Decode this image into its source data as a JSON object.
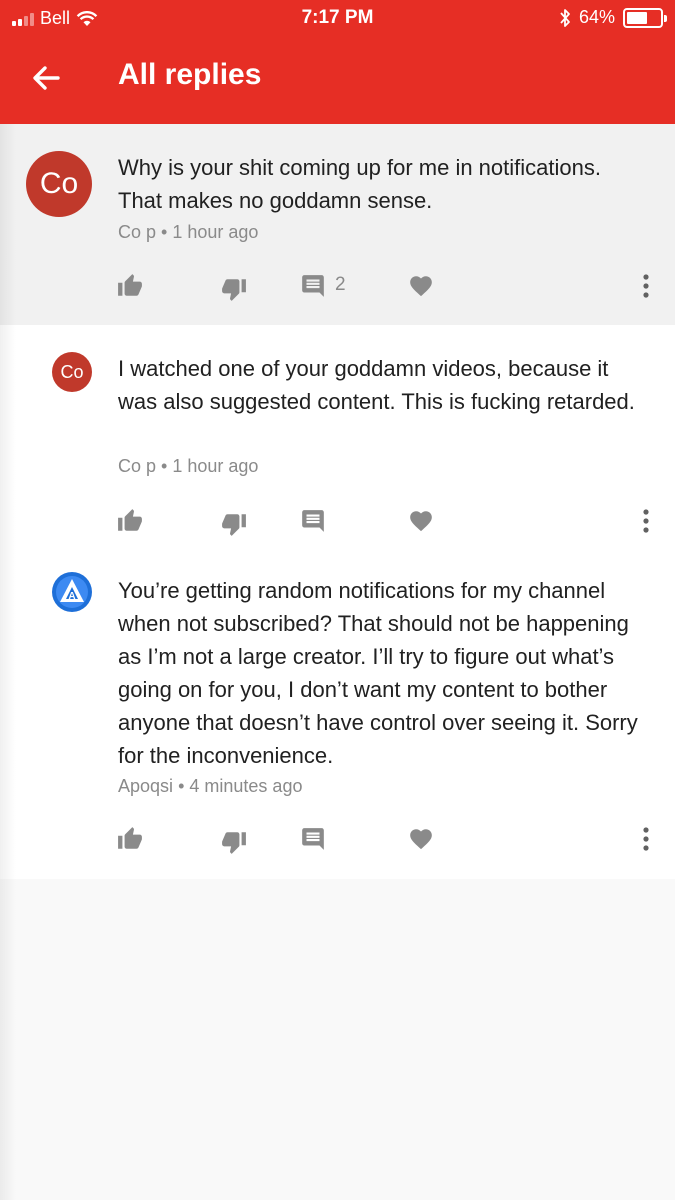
{
  "status_bar": {
    "carrier": "Bell",
    "time": "7:17 PM",
    "battery": "64%",
    "battery_level": 0.64
  },
  "header": {
    "title": "All replies",
    "accent_color": "#e62e25"
  },
  "comments": [
    {
      "avatar_text": "Co",
      "text": "Why is your shit coming up for me in notifications. That makes no goddamn sense.",
      "author": "Co p",
      "separator": "•",
      "time": "1 hour ago",
      "reply_count": "2"
    },
    {
      "avatar_text": "Co",
      "text": "I watched one of your goddamn videos, because it was also suggested content. This is fucking retarded.",
      "author": "Co p",
      "separator": "•",
      "time": "1 hour ago"
    },
    {
      "avatar_text": "A",
      "text": "You’re getting random notifications for my channel when not subscribed? That should not be happening as I’m not a large creator. I’ll try to figure out what’s going on for you, I don’t want my content to bother anyone that doesn’t have control over seeing it. Sorry for the inconvenience.",
      "author": "Apoqsi",
      "separator": "•",
      "time": "4 minutes ago"
    }
  ],
  "icons": [
    "back-arrow-icon",
    "thumbs-up-icon",
    "thumbs-down-icon",
    "reply-icon",
    "heart-icon",
    "more-vert-icon"
  ]
}
